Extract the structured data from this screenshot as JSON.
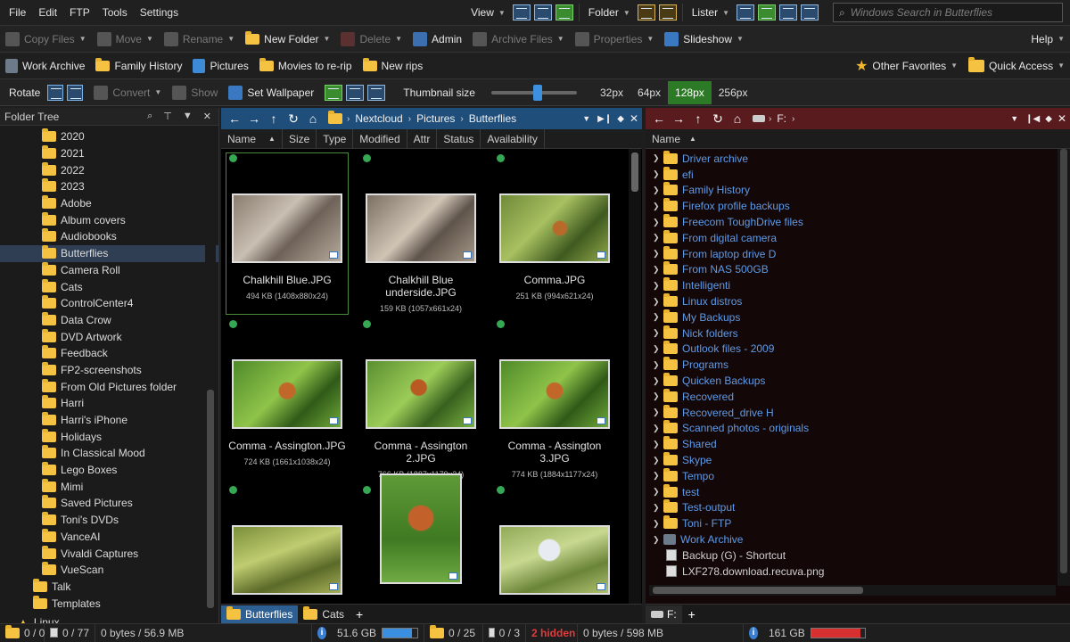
{
  "menu": [
    "File",
    "Edit",
    "FTP",
    "Tools",
    "Settings"
  ],
  "menu_right": {
    "view": "View",
    "folder": "Folder",
    "lister": "Lister",
    "search_placeholder": "Windows Search in Butterflies"
  },
  "toolbar1": {
    "copy": "Copy Files",
    "move": "Move",
    "rename": "Rename",
    "new_folder": "New Folder",
    "delete": "Delete",
    "admin": "Admin",
    "archive": "Archive Files",
    "properties": "Properties",
    "slideshow": "Slideshow",
    "help": "Help"
  },
  "favorites": {
    "items": [
      "Work Archive",
      "Family History",
      "Pictures",
      "Movies to re-rip",
      "New rips"
    ],
    "other": "Other Favorites",
    "quick": "Quick Access"
  },
  "toolbar2": {
    "rotate": "Rotate",
    "convert": "Convert",
    "show": "Show",
    "wallpaper": "Set Wallpaper",
    "thumb_label": "Thumbnail size",
    "sizes": [
      "32px",
      "64px",
      "128px",
      "256px"
    ],
    "selected_size": "128px",
    "slider_level": 0.55
  },
  "tree": {
    "title": "Folder Tree",
    "items": [
      {
        "label": "2020",
        "level": 2
      },
      {
        "label": "2021",
        "level": 2
      },
      {
        "label": "2022",
        "level": 2
      },
      {
        "label": "2023",
        "level": 2
      },
      {
        "label": "Adobe",
        "level": 2
      },
      {
        "label": "Album covers",
        "level": 2
      },
      {
        "label": "Audiobooks",
        "level": 2
      },
      {
        "label": "Butterflies",
        "level": 2,
        "selected": true
      },
      {
        "label": "Camera Roll",
        "level": 2
      },
      {
        "label": "Cats",
        "level": 2
      },
      {
        "label": "ControlCenter4",
        "level": 2
      },
      {
        "label": "Data Crow",
        "level": 2
      },
      {
        "label": "DVD Artwork",
        "level": 2
      },
      {
        "label": "Feedback",
        "level": 2
      },
      {
        "label": "FP2-screenshots",
        "level": 2
      },
      {
        "label": "From Old Pictures folder",
        "level": 2
      },
      {
        "label": "Harri",
        "level": 2
      },
      {
        "label": "Harri's iPhone",
        "level": 2
      },
      {
        "label": "Holidays",
        "level": 2
      },
      {
        "label": "In Classical Mood",
        "level": 2
      },
      {
        "label": "Lego Boxes",
        "level": 2
      },
      {
        "label": "Mimi",
        "level": 2
      },
      {
        "label": "Saved Pictures",
        "level": 2
      },
      {
        "label": "Toni's DVDs",
        "level": 2
      },
      {
        "label": "VanceAI",
        "level": 2
      },
      {
        "label": "Vivaldi Captures",
        "level": 2
      },
      {
        "label": "VueScan",
        "level": 2
      },
      {
        "label": "Talk",
        "level": 1
      },
      {
        "label": "Templates",
        "level": 1
      }
    ],
    "drive": "Linux"
  },
  "left_pane": {
    "breadcrumb": [
      "Nextcloud",
      "Pictures",
      "Butterflies"
    ],
    "columns": [
      "Name",
      "Size",
      "Type",
      "Modified",
      "Attr",
      "Status",
      "Availability"
    ],
    "thumbs": [
      {
        "name": "Chalkhill Blue.JPG",
        "meta": "494 KB (1408x880x24)",
        "tone": "stone",
        "selected": true
      },
      {
        "name": "Chalkhill Blue underside.JPG",
        "meta": "159 KB (1057x661x24)",
        "tone": "stone2"
      },
      {
        "name": "Comma.JPG",
        "meta": "251 KB (994x621x24)",
        "tone": "green"
      },
      {
        "name": "Comma - Assington.JPG",
        "meta": "724 KB (1661x1038x24)",
        "tone": "green2"
      },
      {
        "name": "Comma - Assington 2.JPG",
        "meta": "766 KB (1887x1179x24)",
        "tone": "green3"
      },
      {
        "name": "Comma - Assington 3.JPG",
        "meta": "774 KB (1884x1177x24)",
        "tone": "green2"
      },
      {
        "name": "",
        "meta": "",
        "tone": "grass"
      },
      {
        "name": "",
        "meta": "",
        "tone": "tall"
      },
      {
        "name": "",
        "meta": "",
        "tone": "white"
      }
    ],
    "tabs": [
      "Butterflies",
      "Cats"
    ]
  },
  "right_pane": {
    "drive": "F:",
    "column": "Name",
    "folders": [
      "Driver archive",
      "efi",
      "Family History",
      "Firefox profile backups",
      "Freecom ToughDrive files",
      "From digital camera",
      "From laptop drive D",
      "From NAS 500GB",
      "Intelligenti",
      "Linux distros",
      "My Backups",
      "Nick folders",
      "Outlook files - 2009",
      "Programs",
      "Quicken Backups",
      "Recovered",
      "Recovered_drive H",
      "Scanned photos - originals",
      "Shared",
      "Skype",
      "Tempo",
      "test",
      "Test-output",
      "Toni - FTP",
      "Work Archive"
    ],
    "files": [
      "Backup (G) - Shortcut",
      "LXF278.download.recuva.png"
    ],
    "tab": "F:"
  },
  "status": {
    "left_folders": "0 / 0",
    "left_files": "0 / 77",
    "left_bytes": "0 bytes / 56.9 MB",
    "left_free": "51.6 GB",
    "left_used_fraction": 0.55,
    "right_folders": "0 / 25",
    "right_files": "0 / 3",
    "right_hidden": "2 hidden",
    "right_bytes": "0 bytes / 598 MB",
    "right_free": "161 GB",
    "right_used_fraction": 0.92
  },
  "colors": {
    "accent_blue": "#1f4e7a",
    "right_dest": "#5a1b1e",
    "selection_green": "#2d7a26"
  }
}
